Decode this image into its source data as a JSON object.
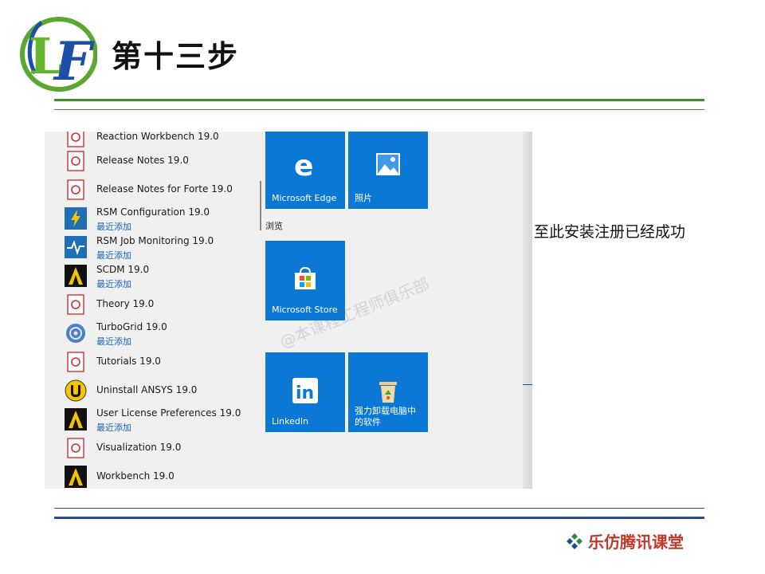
{
  "slide": {
    "title": "第十三步",
    "caption": "至此安装注册已经成功",
    "footer_brand": "乐仿腾讯课堂",
    "logo_icon": "lf-logo-icon",
    "brand_icon": "diamond-cluster-icon"
  },
  "start_menu": {
    "apps": [
      {
        "name": "Reaction Workbench 19.0",
        "sub": "",
        "icon": "pdf-doc-icon"
      },
      {
        "name": "Release Notes 19.0",
        "sub": "",
        "icon": "pdf-doc-icon"
      },
      {
        "name": "Release Notes for Forte 19.0",
        "sub": "",
        "icon": "pdf-doc-icon"
      },
      {
        "name": "RSM Configuration 19.0",
        "sub": "最近添加",
        "icon": "rsm-config-icon"
      },
      {
        "name": "RSM Job Monitoring 19.0",
        "sub": "最近添加",
        "icon": "rsm-monitor-icon"
      },
      {
        "name": "SCDM 19.0",
        "sub": "最近添加",
        "icon": "ansys-logo-icon"
      },
      {
        "name": "Theory 19.0",
        "sub": "",
        "icon": "pdf-doc-icon"
      },
      {
        "name": "TurboGrid 19.0",
        "sub": "最近添加",
        "icon": "turbogrid-icon"
      },
      {
        "name": "Tutorials 19.0",
        "sub": "",
        "icon": "pdf-doc-icon"
      },
      {
        "name": "Uninstall ANSYS 19.0",
        "sub": "",
        "icon": "uninstall-icon"
      },
      {
        "name": "User License Preferences 19.0",
        "sub": "最近添加",
        "icon": "ansys-logo-icon"
      },
      {
        "name": "Visualization 19.0",
        "sub": "",
        "icon": "pdf-doc-icon"
      },
      {
        "name": "Workbench 19.0",
        "sub": "",
        "icon": "ansys-logo-icon"
      }
    ],
    "group_label": "浏览",
    "tiles": [
      {
        "label": "Microsoft Edge",
        "icon": "edge-icon"
      },
      {
        "label": "照片",
        "icon": "photos-icon"
      },
      {
        "label": "Microsoft Store",
        "icon": "store-icon"
      },
      {
        "label": "LinkedIn",
        "icon": "linkedin-icon"
      },
      {
        "label": "强力卸载电脑中的软件",
        "icon": "recycle-bin-icon"
      }
    ],
    "watermark": "@本课程工程师俱乐部"
  },
  "colors": {
    "tile_blue": "#0a78d4",
    "recent_added_blue": "#1464b4",
    "header_green": "#3f8f2c",
    "footer_blue": "#2a4a8a",
    "brand_red": "#c0392b"
  }
}
